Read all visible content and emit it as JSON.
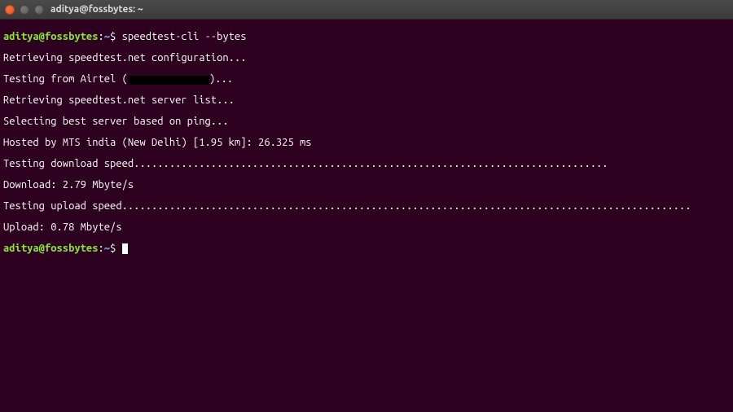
{
  "window": {
    "title": "aditya@fossbytes: ~"
  },
  "prompt": {
    "user_host": "aditya@fossbytes",
    "path": "~",
    "symbol": "$"
  },
  "command": "speedtest-cli --bytes",
  "output": {
    "line1": "Retrieving speedtest.net configuration...",
    "line2a": "Testing from Airtel (",
    "line2b": ")...",
    "line3": "Retrieving speedtest.net server list...",
    "line4": "Selecting best server based on ping...",
    "line5": "Hosted by MTS india (New Delhi) [1.95 km]: 26.325 ms",
    "line6": "Testing download speed................................................................................",
    "line7": "Download: 2.79 Mbyte/s",
    "line8": "Testing upload speed................................................................................................",
    "line9": "Upload: 0.78 Mbyte/s"
  }
}
